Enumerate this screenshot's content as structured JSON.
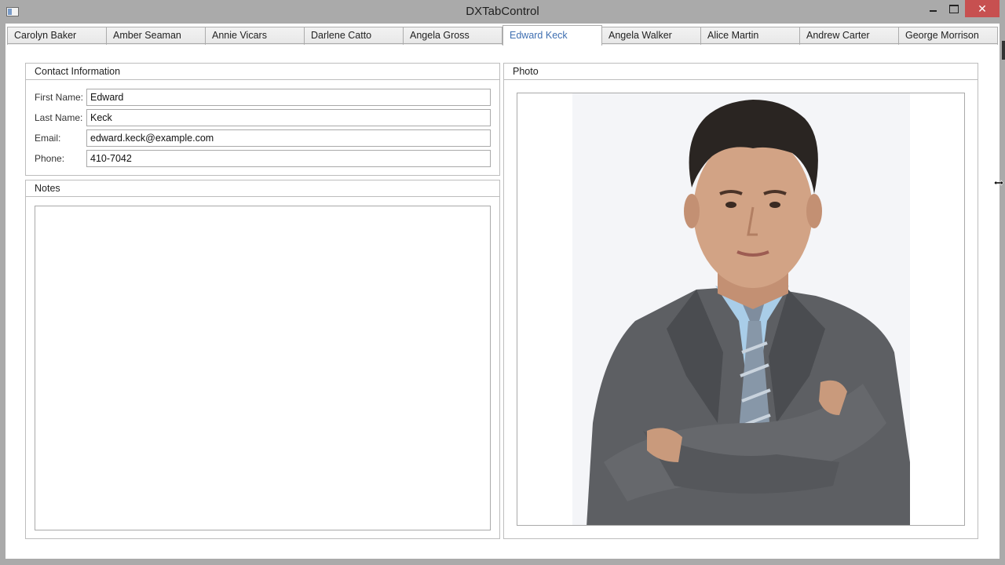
{
  "window": {
    "title": "DXTabControl",
    "close_glyph": "✕"
  },
  "tabs": [
    {
      "label": "Carolyn Baker"
    },
    {
      "label": "Amber Seaman"
    },
    {
      "label": "Annie Vicars"
    },
    {
      "label": "Darlene Catto"
    },
    {
      "label": "Angela Gross"
    },
    {
      "label": "Edward Keck",
      "selected": true
    },
    {
      "label": "Angela Walker"
    },
    {
      "label": "Alice Martin"
    },
    {
      "label": "Andrew Carter"
    },
    {
      "label": "George Morrison"
    }
  ],
  "contact": {
    "header": "Contact Information",
    "first_name_label": "First Name:",
    "first_name": "Edward",
    "last_name_label": "Last Name:",
    "last_name": "Keck",
    "email_label": "Email:",
    "email": "edward.keck@example.com",
    "phone_label": "Phone:",
    "phone": "410-7042"
  },
  "notes": {
    "header": "Notes",
    "value": ""
  },
  "photo": {
    "header": "Photo",
    "icon": "person-portrait-icon"
  },
  "colors": {
    "active_tab_text": "#3f6fb1",
    "close_button": "#c75050",
    "suit": "#5d5f63",
    "shirt": "#a9cde8"
  }
}
